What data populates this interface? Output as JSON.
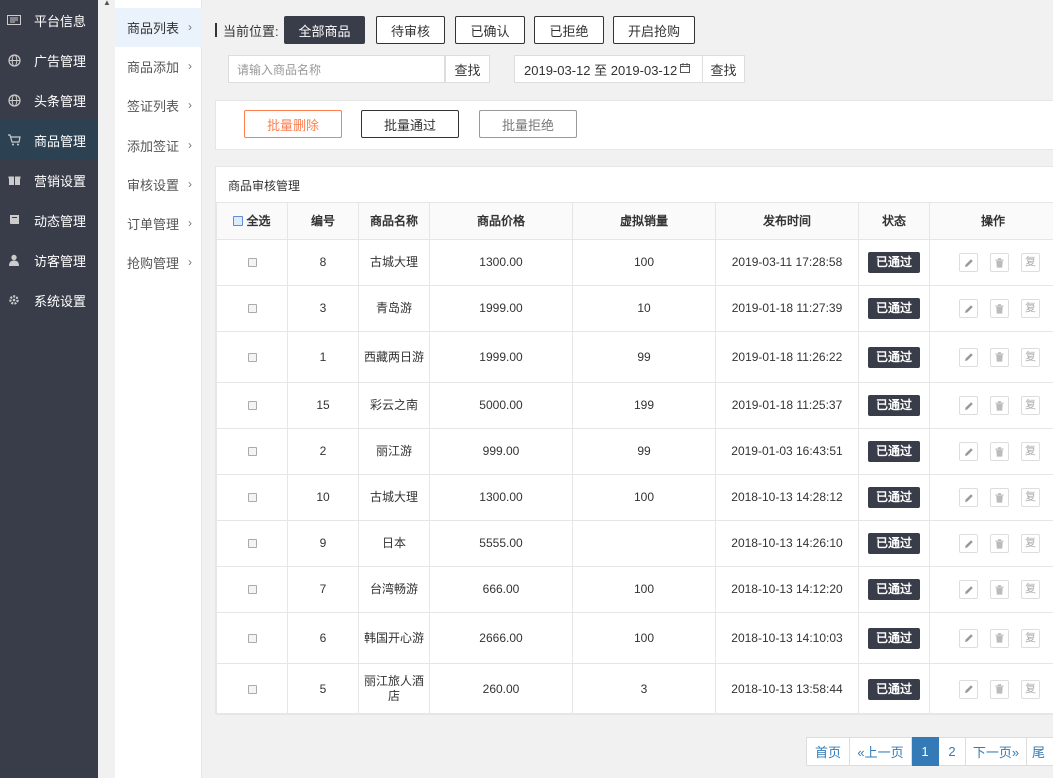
{
  "sidebar": {
    "items": [
      {
        "label": "平台信息",
        "icon": "newspaper-icon"
      },
      {
        "label": "广告管理",
        "icon": "globe-icon"
      },
      {
        "label": "头条管理",
        "icon": "globe-icon"
      },
      {
        "label": "商品管理",
        "icon": "cart-icon",
        "active": true
      },
      {
        "label": "营销设置",
        "icon": "gift-icon"
      },
      {
        "label": "动态管理",
        "icon": "book-icon"
      },
      {
        "label": "访客管理",
        "icon": "user-icon"
      },
      {
        "label": "系统设置",
        "icon": "gear-icon"
      }
    ]
  },
  "subnav": {
    "items": [
      {
        "label": "商品列表",
        "active": true
      },
      {
        "label": "商品添加"
      },
      {
        "label": "签证列表"
      },
      {
        "label": "添加签证"
      },
      {
        "label": "审核设置"
      },
      {
        "label": "订单管理"
      },
      {
        "label": "抢购管理"
      }
    ],
    "chevron": "›"
  },
  "location": {
    "label": "当前位置:",
    "tabs": [
      "全部商品",
      "待审核",
      "已确认",
      "已拒绝",
      "开启抢购"
    ]
  },
  "search": {
    "placeholder": "请输入商品名称",
    "button": "查找",
    "date_range": "2019-03-12 至 2019-03-12",
    "date_button": "查找"
  },
  "batch": {
    "delete": "批量删除",
    "approve": "批量通过",
    "reject": "批量拒绝"
  },
  "table": {
    "title": "商品审核管理",
    "select_all": "全选",
    "headers": [
      "编号",
      "商品名称",
      "商品价格",
      "虚拟销量",
      "发布时间",
      "状态",
      "操作"
    ],
    "rows": [
      {
        "id": "8",
        "name": "古城大理",
        "price": "1300.00",
        "sales": "100",
        "time": "2019-03-11 17:28:58",
        "status": "已通过"
      },
      {
        "id": "3",
        "name": "青岛游",
        "price": "1999.00",
        "sales": "10",
        "time": "2019-01-18 11:27:39",
        "status": "已通过"
      },
      {
        "id": "1",
        "name": "西藏两日游",
        "price": "1999.00",
        "sales": "99",
        "time": "2019-01-18 11:26:22",
        "status": "已通过"
      },
      {
        "id": "15",
        "name": "彩云之南",
        "price": "5000.00",
        "sales": "199",
        "time": "2019-01-18 11:25:37",
        "status": "已通过"
      },
      {
        "id": "2",
        "name": "丽江游",
        "price": "999.00",
        "sales": "99",
        "time": "2019-01-03 16:43:51",
        "status": "已通过"
      },
      {
        "id": "10",
        "name": "古城大理",
        "price": "1300.00",
        "sales": "100",
        "time": "2018-10-13 14:28:12",
        "status": "已通过"
      },
      {
        "id": "9",
        "name": "日本",
        "price": "5555.00",
        "sales": "",
        "time": "2018-10-13 14:26:10",
        "status": "已通过"
      },
      {
        "id": "7",
        "name": "台湾畅游",
        "price": "666.00",
        "sales": "100",
        "time": "2018-10-13 14:12:20",
        "status": "已通过"
      },
      {
        "id": "6",
        "name": "韩国开心游",
        "price": "2666.00",
        "sales": "100",
        "time": "2018-10-13 14:10:03",
        "status": "已通过"
      },
      {
        "id": "5",
        "name": "丽江旅人酒店",
        "price": "260.00",
        "sales": "3",
        "time": "2018-10-13 13:58:44",
        "status": "已通过"
      }
    ],
    "op_copy_label": "复"
  },
  "pager": {
    "first": "首页",
    "prev": "«上一页",
    "pages": [
      "1",
      "2"
    ],
    "current": "1",
    "next": "下一页»",
    "last": "尾"
  }
}
